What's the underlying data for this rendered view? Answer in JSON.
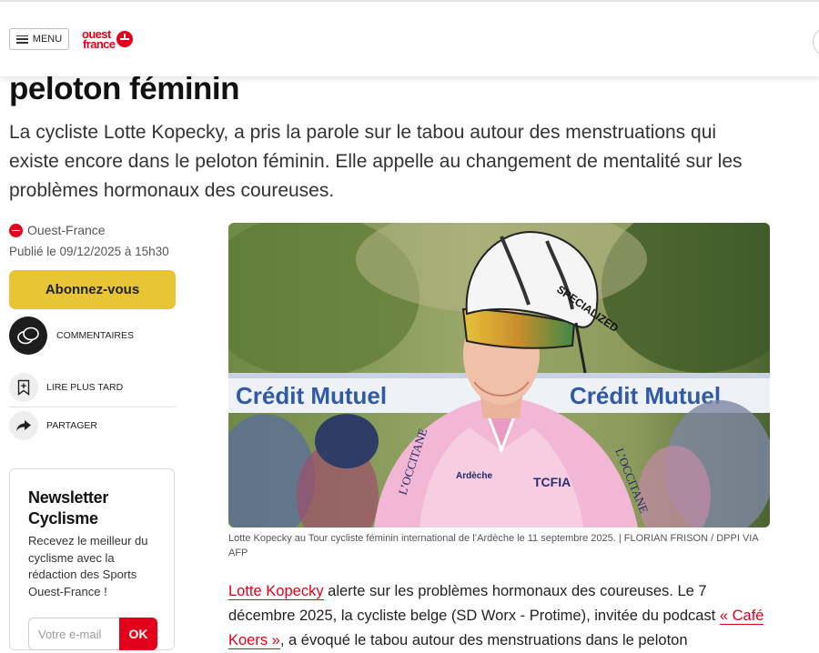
{
  "header": {
    "menu_label": "MENU",
    "logo_line1": "ouest",
    "logo_line2": "france"
  },
  "article": {
    "title": "peloton féminin",
    "lead": "La cycliste Lotte Kopecky, a pris la parole sur le tabou autour des menstruations qui existe encore dans le peloton féminin. Elle appelle au changement de mentalité sur les problèmes hormonaux des coureuses.",
    "source": "Ouest-France",
    "published": "Publié le 09/12/2025 à 15h30",
    "photo_caption": "Lotte Kopecky au Tour cycliste féminin international de l’Ardèche le 11 septembre 2025. | FLORIAN FRISON / DPPI VIA AFP",
    "photo_banner_text": "Crédit Mutuel",
    "photo_jersey_left": "L’OCCITANE",
    "photo_jersey_right": "L’OCCITANE",
    "photo_jersey_sponsor": "Ardèche",
    "photo_jersey_logo": "TCFIA",
    "photo_helmet_text": "SPECIALIZED",
    "body_link1": "Lotte Kopecky",
    "body_part1": " alerte sur les problèmes hormonaux des coureuses. Le 7 décembre 2025, la cycliste belge (SD Worx - Protime), invitée du podcast ",
    "body_link2": "« Café Koers »",
    "body_part2": ", a évoqué le tabou autour des menstruations dans le peloton"
  },
  "sidebar": {
    "subscribe_label": "Abonnez-vous",
    "comments_label": "COMMENTAIRES",
    "read_later_label": "LIRE PLUS TARD",
    "share_label": "PARTAGER"
  },
  "newsletter": {
    "title": "Newsletter Cyclisme",
    "description": "Recevez le meilleur du cyclisme avec la rédaction des Sports Ouest-France !",
    "email_placeholder": "Votre e-mail",
    "ok_label": "OK"
  },
  "colors": {
    "brand_red": "#e2001a",
    "subscribe_yellow": "#e8c535"
  },
  "icons": [
    "menu-icon",
    "ouest-france-logo",
    "search-icon",
    "comment-icon",
    "bookmark-add-icon",
    "share-icon"
  ]
}
